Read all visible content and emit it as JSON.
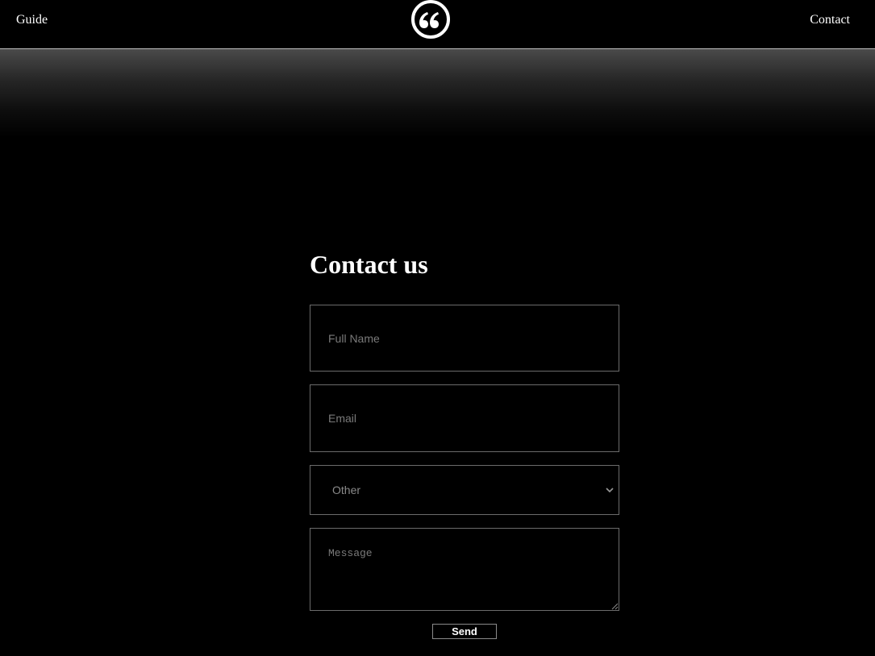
{
  "nav": {
    "left_link": "Guide",
    "right_link": "Contact",
    "logo_icon": "quote-icon"
  },
  "form": {
    "title": "Contact us",
    "name_placeholder": "Full Name",
    "email_placeholder": "Email",
    "topic_selected": "Other",
    "message_placeholder": "Message",
    "send_label": "Send"
  },
  "colors": {
    "background": "#000000",
    "text": "#ffffff",
    "field_border": "#6b6b6b",
    "placeholder": "#7a7a7a"
  }
}
